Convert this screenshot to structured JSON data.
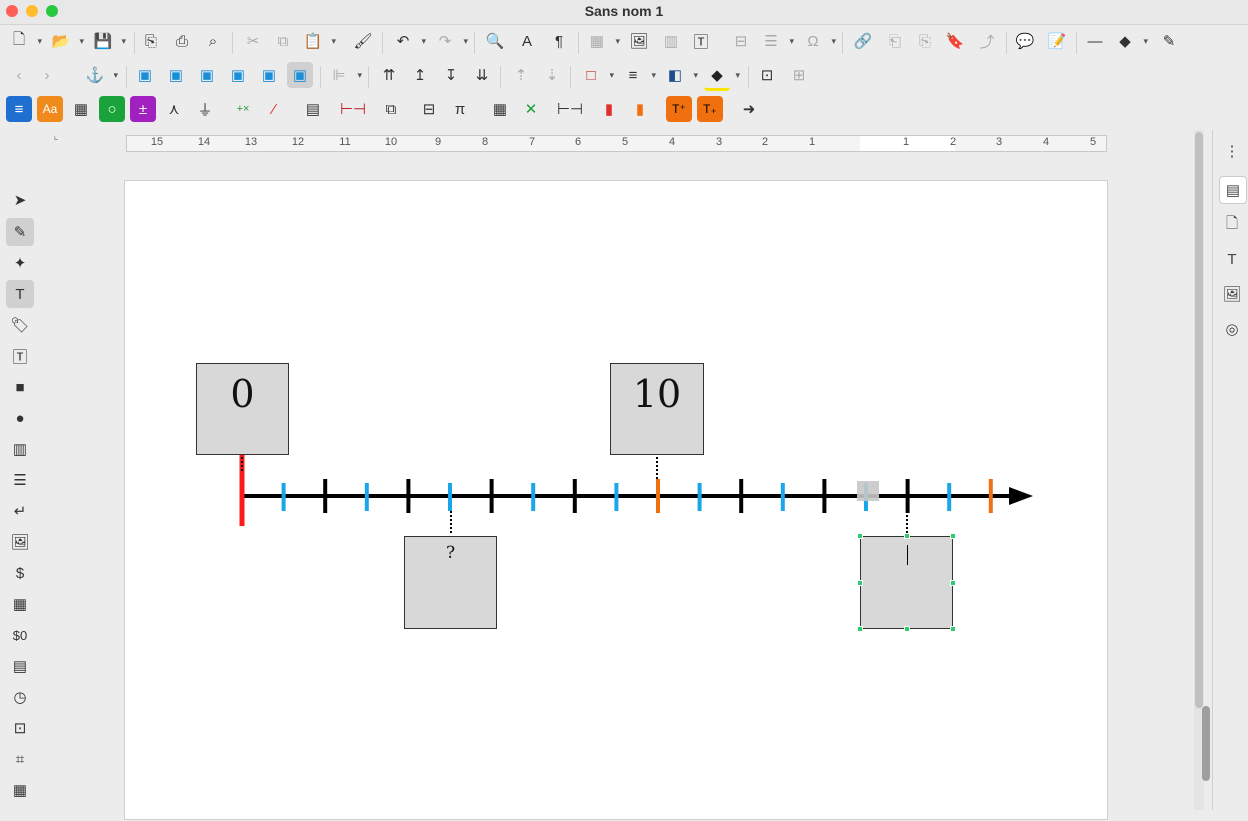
{
  "window": {
    "title": "Sans nom 1",
    "traffic_colors": [
      "#fe5f57",
      "#febc2e",
      "#28c840"
    ]
  },
  "ruler": {
    "numbers": [
      "15",
      "14",
      "13",
      "12",
      "11",
      "10",
      "9",
      "8",
      "7",
      "6",
      "5",
      "4",
      "3",
      "2",
      "1",
      "1",
      "2",
      "3",
      "4",
      "5"
    ]
  },
  "document": {
    "boxes": [
      {
        "id": "zero",
        "label": "0"
      },
      {
        "id": "ten",
        "label": "10"
      },
      {
        "id": "question",
        "label": "?"
      },
      {
        "id": "empty",
        "label": ""
      }
    ],
    "colors": {
      "axis": "#000000",
      "origin_tick": "#ff1a1a",
      "major_tick": "#000000",
      "minor_tick": "#1aa6e8",
      "marker_tick": "#f07010",
      "box_fill": "#d8d8d8",
      "handle": "#2ecc71"
    }
  },
  "icons": {
    "toolbar1": [
      "new-document-icon",
      "open-icon",
      "save-icon",
      "export-pdf-icon",
      "print-icon",
      "print-preview-icon",
      "cut-icon",
      "copy-icon",
      "paste-icon",
      "clone-formatting-icon",
      "undo-icon",
      "redo-icon",
      "find-replace-icon",
      "spellcheck-icon",
      "formatting-marks-icon",
      "insert-table-icon",
      "insert-image-icon",
      "insert-chart-icon",
      "insert-textbox-icon",
      "insert-page-break-icon",
      "insert-field-icon",
      "special-character-icon",
      "hyperlink-icon",
      "footnote-icon",
      "endnote-icon",
      "bookmark-icon",
      "cross-reference-icon",
      "comment-icon",
      "track-changes-icon",
      "line-icon",
      "basic-shapes-icon",
      "draw-icon"
    ],
    "toolbar2": [
      "back-icon",
      "forward-icon",
      "anchor-icon",
      "wrap-off-icon",
      "wrap-page-icon",
      "wrap-optimal-icon",
      "wrap-left-icon",
      "wrap-right-icon",
      "wrap-through-icon",
      "align-objects-icon",
      "bring-front-icon",
      "forward-one-icon",
      "backward-one-icon",
      "send-back-icon",
      "to-foreground-icon",
      "to-background-icon",
      "border-style-icon",
      "line-style-icon",
      "border-color-icon",
      "area-fill-icon",
      "link-frames-icon",
      "unlink-frames-icon"
    ],
    "toolbar3": [
      "lines-icon",
      "style-aa-icon",
      "grid-icon",
      "circle-icon",
      "plus-minus-icon",
      "node-icon",
      "plug-icon",
      "math-ops-icon",
      "slash-icon",
      "calculator-icon",
      "dimension-line-icon",
      "frame-icon",
      "align-center-icon",
      "pi-icon",
      "table-grid-icon",
      "delete-x-icon",
      "ruler-line-icon",
      "red-tick-icon",
      "orange-tick-icon",
      "text-increase-icon",
      "text-decrease-icon",
      "arrow-right-icon"
    ],
    "left": [
      "select-icon",
      "pencil-icon",
      "magic-wand-icon",
      "text-tool-icon",
      "tag-icon",
      "textbox-icon",
      "rectangle-icon",
      "ellipse-icon",
      "page-icon",
      "list-icon",
      "return-icon",
      "image-icon",
      "dollar-icon",
      "calendar-icon",
      "dollar-zero-icon",
      "form-icon",
      "clock-icon",
      "camera-icon",
      "grid-select-icon",
      "table-icon"
    ],
    "right": [
      "more-icon",
      "properties-icon",
      "page-icon",
      "styles-icon",
      "gallery-icon",
      "navigator-icon"
    ]
  }
}
